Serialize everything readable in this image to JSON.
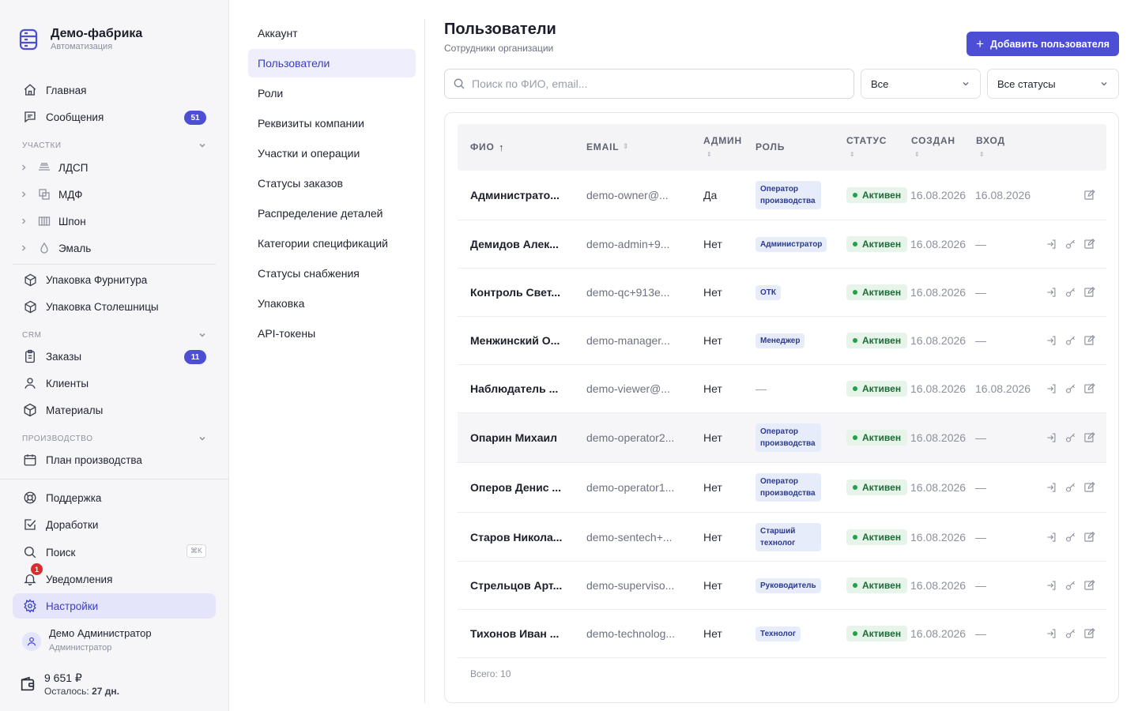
{
  "brand": {
    "name": "Демо-фабрика",
    "subtitle": "Автоматизация"
  },
  "sidebar": {
    "home": "Главная",
    "messages": {
      "label": "Сообщения",
      "badge": "51"
    },
    "sections": {
      "areas": "УЧАСТКИ",
      "crm": "CRM",
      "production": "ПРОИЗВОДСТВО"
    },
    "areas": [
      "ЛДСП",
      "МДФ",
      "Шпон",
      "Эмаль"
    ],
    "packaging_hardware": "Упаковка Фурнитура",
    "packaging_countertops": "Упаковка Столешницы",
    "orders": {
      "label": "Заказы",
      "badge": "11"
    },
    "clients": "Клиенты",
    "materials": "Материалы",
    "production_plan": "План производства",
    "support": "Поддержка",
    "improvements": "Доработки",
    "search": {
      "label": "Поиск",
      "shortcut": "⌘K"
    },
    "notifications": {
      "label": "Уведомления",
      "badge": "1"
    },
    "settings": "Настройки",
    "user": {
      "name": "Демо Администратор",
      "role": "Администратор"
    },
    "balance": {
      "amount": "9 651 ₽",
      "left_label": "Осталось:",
      "left_value": "27 дн."
    }
  },
  "settings_nav": [
    "Аккаунт",
    "Пользователи",
    "Роли",
    "Реквизиты компании",
    "Участки и операции",
    "Статусы заказов",
    "Распределение деталей",
    "Категории спецификаций",
    "Статусы снабжения",
    "Упаковка",
    "API-токены"
  ],
  "main": {
    "title": "Пользователи",
    "subtitle": "Сотрудники организации",
    "add_button": "Добавить пользователя",
    "search_placeholder": "Поиск по ФИО, email...",
    "filter_role": "Все",
    "filter_status": "Все статусы",
    "columns": {
      "name": "ФИО",
      "email": "EMAIL",
      "admin": "АДМИН",
      "role": "РОЛЬ",
      "status": "СТАТУС",
      "created": "СОЗДАН",
      "login": "ВХОД"
    },
    "rows": [
      {
        "name": "Администрато...",
        "email": "demo-owner@...",
        "admin": "Да",
        "role": "Оператор производства",
        "status": "Активен",
        "created": "16.08.2026",
        "login": "16.08.2026"
      },
      {
        "name": "Демидов Алек...",
        "email": "demo-admin+9...",
        "admin": "Нет",
        "role": "Администратор",
        "status": "Активен",
        "created": "16.08.2026",
        "login": "—"
      },
      {
        "name": "Контроль Свет...",
        "email": "demo-qc+913e...",
        "admin": "Нет",
        "role": "ОТК",
        "status": "Активен",
        "created": "16.08.2026",
        "login": "—"
      },
      {
        "name": "Менжинский О...",
        "email": "demo-manager...",
        "admin": "Нет",
        "role": "Менеджер",
        "status": "Активен",
        "created": "16.08.2026",
        "login": "—"
      },
      {
        "name": "Наблюдатель ...",
        "email": "demo-viewer@...",
        "admin": "Нет",
        "role": "—",
        "status": "Активен",
        "created": "16.08.2026",
        "login": "16.08.2026"
      },
      {
        "name": "Опарин Михаил",
        "email": "demo-operator2...",
        "admin": "Нет",
        "role": "Оператор производства",
        "status": "Активен",
        "created": "16.08.2026",
        "login": "—"
      },
      {
        "name": "Оперов Денис ...",
        "email": "demo-operator1...",
        "admin": "Нет",
        "role": "Оператор производства",
        "status": "Активен",
        "created": "16.08.2026",
        "login": "—"
      },
      {
        "name": "Старов Никола...",
        "email": "demo-sentech+...",
        "admin": "Нет",
        "role": "Старший технолог",
        "status": "Активен",
        "created": "16.08.2026",
        "login": "—"
      },
      {
        "name": "Стрельцов Арт...",
        "email": "demo-superviso...",
        "admin": "Нет",
        "role": "Руководитель",
        "status": "Активен",
        "created": "16.08.2026",
        "login": "—"
      },
      {
        "name": "Тихонов Иван ...",
        "email": "demo-technolog...",
        "admin": "Нет",
        "role": "Технолог",
        "status": "Активен",
        "created": "16.08.2026",
        "login": "—"
      }
    ],
    "total": "Всего: 10"
  },
  "colors": {
    "accent": "#4c4fd6",
    "status_active_bg": "#e6f4ea",
    "status_active_text": "#1d6b37",
    "role_badge_bg": "#e7ecfb",
    "notification_badge": "#d92d2d"
  }
}
